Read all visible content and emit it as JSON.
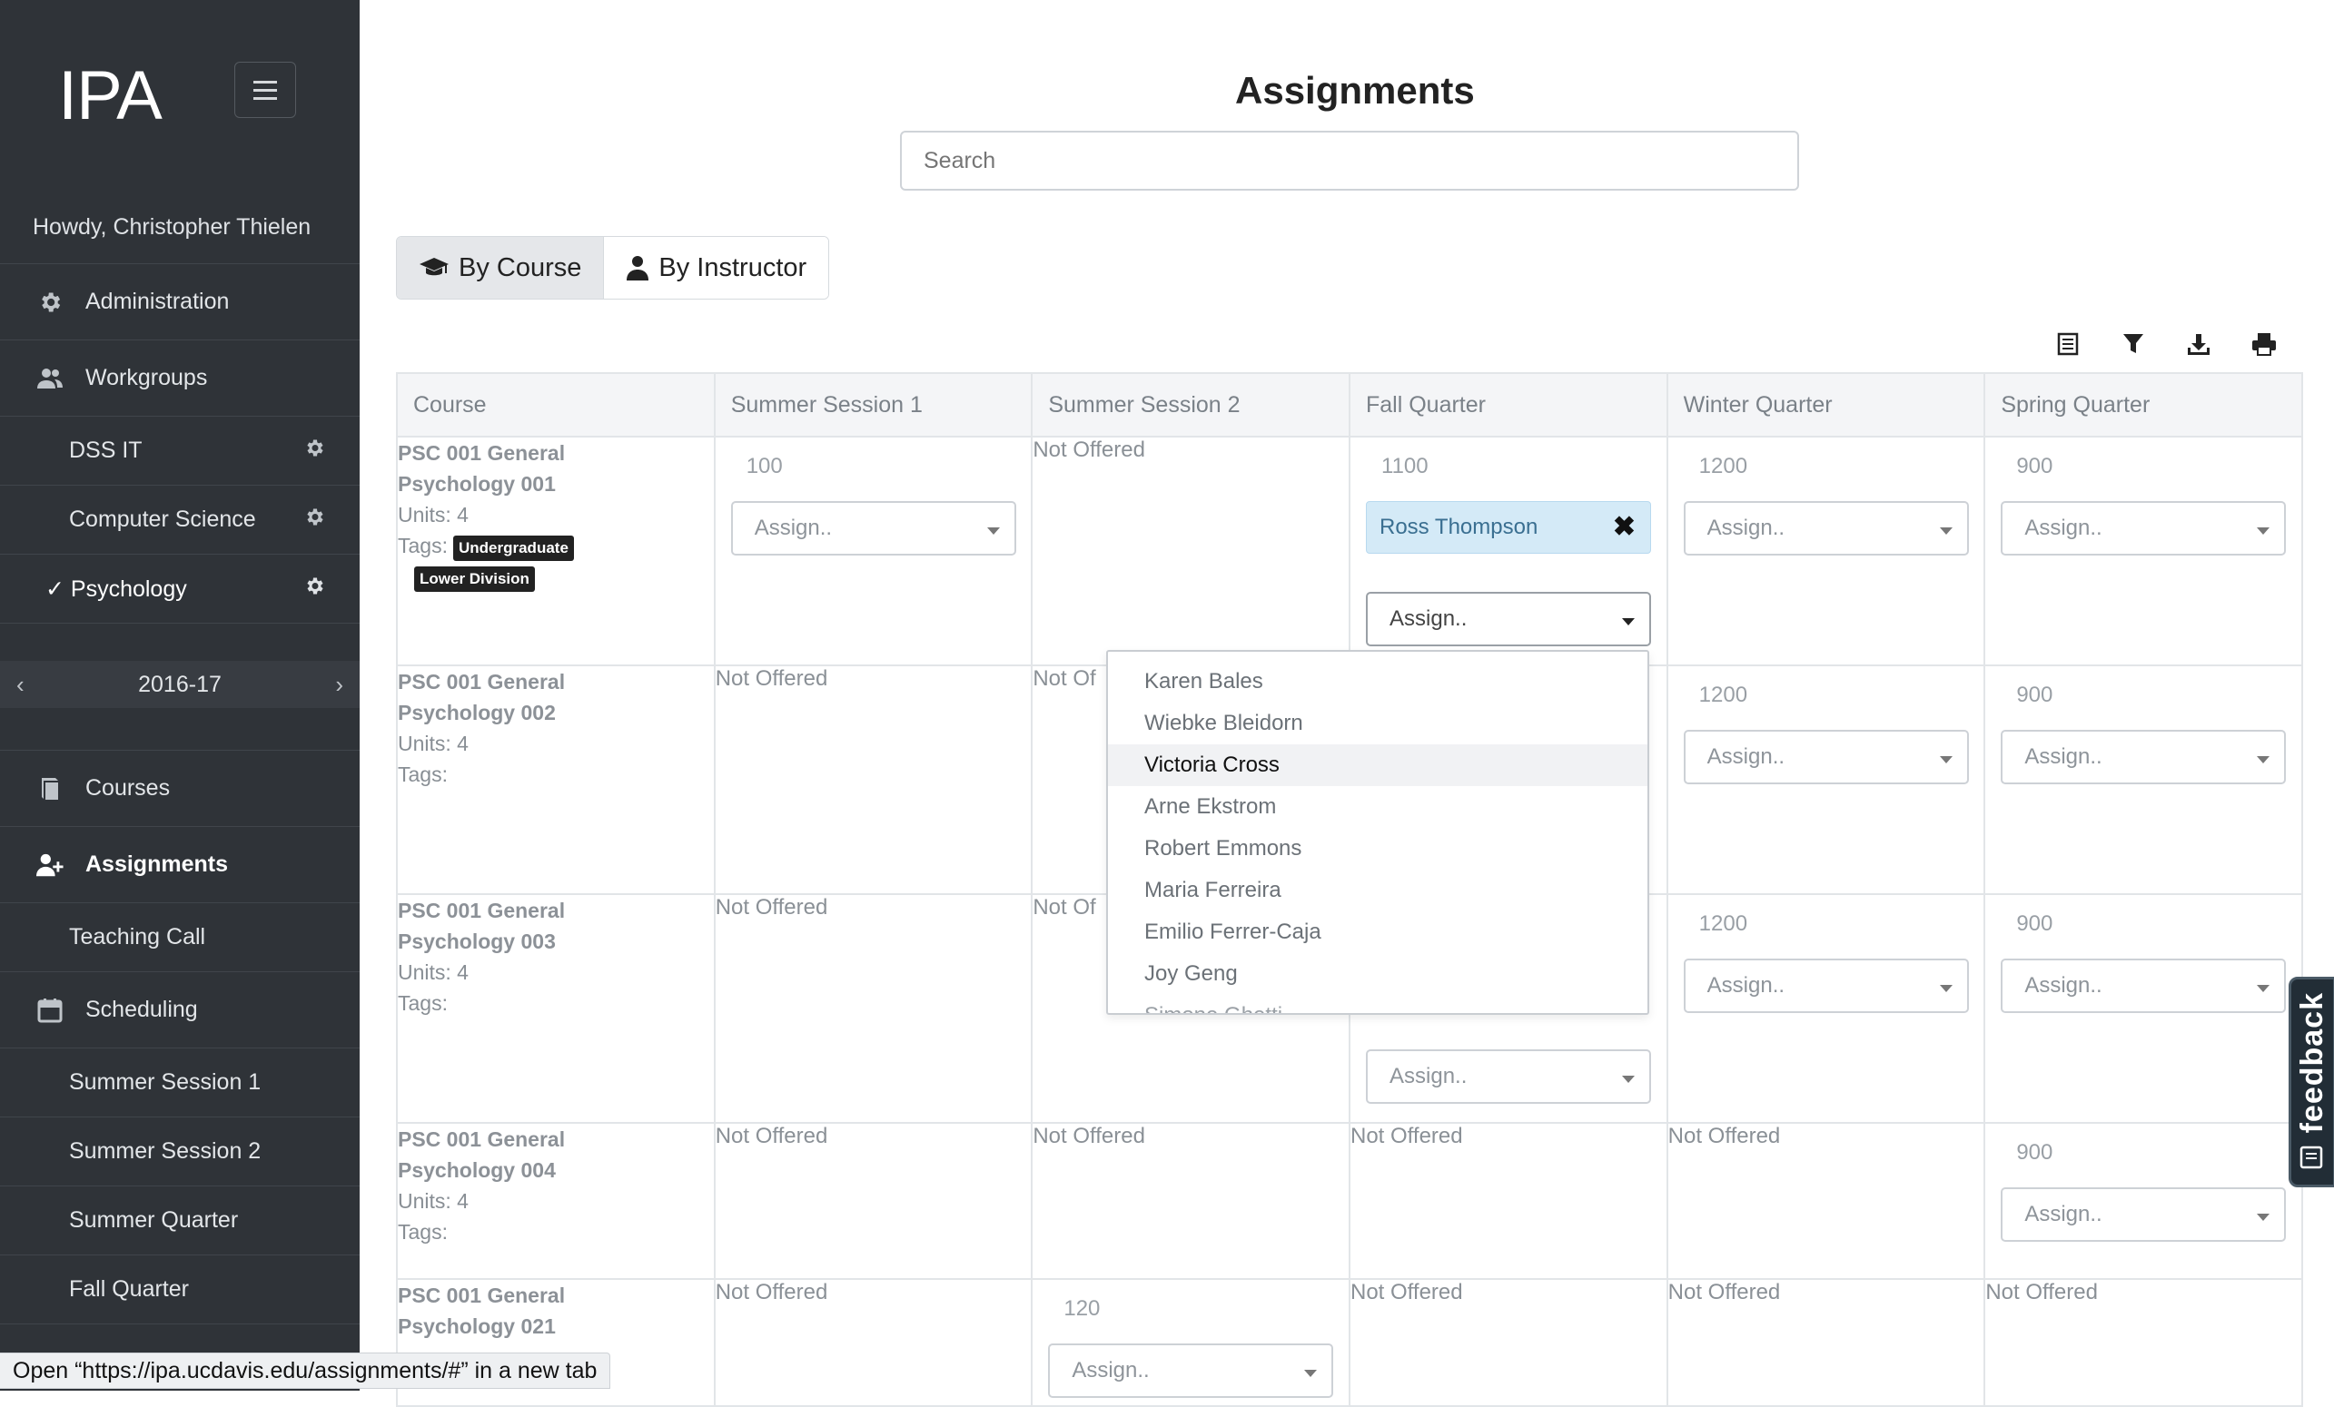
{
  "app": {
    "logo": "IPA",
    "greeting": "Howdy, Christopher Thielen",
    "year": "2016-17"
  },
  "sidebar": {
    "items": [
      {
        "label": "Administration",
        "icon": "gear-icon"
      },
      {
        "label": "Workgroups",
        "icon": "users-icon"
      },
      {
        "label": "DSS IT",
        "icon": "gear-icon"
      },
      {
        "label": "Computer Science",
        "icon": "gear-icon"
      },
      {
        "label": "✓ Psychology",
        "icon": "gear-icon"
      },
      {
        "label": "Courses",
        "icon": "book-icon"
      },
      {
        "label": "Assignments",
        "icon": "user-plus-icon"
      },
      {
        "label": "Teaching Call"
      },
      {
        "label": "Scheduling",
        "icon": "calendar-icon"
      },
      {
        "label": "Summer Session 1"
      },
      {
        "label": "Summer Session 2"
      },
      {
        "label": "Summer Quarter"
      },
      {
        "label": "Fall Quarter"
      }
    ]
  },
  "main": {
    "title": "Assignments",
    "search_placeholder": "Search",
    "view_toggle": {
      "by_course": "By Course",
      "by_instructor": "By Instructor",
      "selected": "By Course"
    }
  },
  "table": {
    "headers": [
      "Course",
      "Summer Session 1",
      "Summer Session 2",
      "Fall Quarter",
      "Winter Quarter",
      "Spring Quarter"
    ],
    "assign_placeholder": "Assign..",
    "not_offered": "Not Offered",
    "rows": [
      {
        "name_line1": "PSC 001 General",
        "name_line2": "Psychology 001",
        "units": "Units: 4",
        "tags_label": "Tags:",
        "tags": [
          "Undergraduate",
          "Lower Division"
        ],
        "s1": "100",
        "s2": "Not Offered",
        "fall": "1100",
        "winter": "1200",
        "spring": "900",
        "fall_assigned": "Ross Thompson"
      },
      {
        "name_line1": "PSC 001 General",
        "name_line2": "Psychology 002",
        "units": "Units: 4",
        "tags_label": "Tags:",
        "s1": "Not Offered",
        "s2": "Not Of",
        "winter": "1200",
        "spring": "900"
      },
      {
        "name_line1": "PSC 001 General",
        "name_line2": "Psychology 003",
        "units": "Units: 4",
        "tags_label": "Tags:",
        "s1": "Not Offered",
        "s2": "Not Of",
        "winter": "1200",
        "spring": "900"
      },
      {
        "name_line1": "PSC 001 General",
        "name_line2": "Psychology 004",
        "units": "Units: 4",
        "tags_label": "Tags:",
        "s1": "Not Offered",
        "s2": "Not Offered",
        "fall": "Not Offered",
        "winter": "Not Offered",
        "spring": "900"
      },
      {
        "name_line1": "PSC 001 General",
        "name_line2": "Psychology 021",
        "s1": "Not Offered",
        "s2": "120",
        "fall": "Not Offered",
        "winter": "Not Offered",
        "spring": "Not Offered"
      }
    ]
  },
  "dropdown": {
    "options": [
      "Karen Bales",
      "Wiebke Bleidorn",
      "Victoria Cross",
      "Arne Ekstrom",
      "Robert Emmons",
      "Maria Ferreira",
      "Emilio Ferrer-Caja",
      "Joy Geng",
      "Simone Ghetti"
    ],
    "highlighted": "Victoria Cross"
  },
  "feedback": {
    "label": "feedback"
  },
  "status_bar": {
    "text": "Open “https://ipa.ucdavis.edu/assignments/#” in a new tab"
  }
}
